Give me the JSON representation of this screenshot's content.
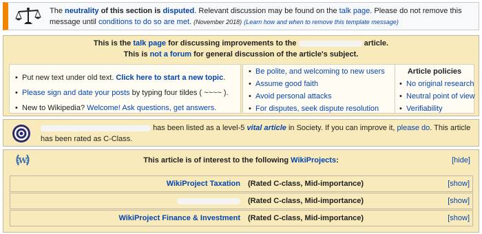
{
  "dispute": {
    "icon": "scales-icon",
    "prefix": "The ",
    "neutrality_link": "neutrality",
    "mid1": " of this section is ",
    "disputed_link": "disputed",
    "mid2": ". Relevant discussion may be found on the ",
    "talk_link": "talk page",
    "mid3": ". Please do not remove this message until ",
    "conditions_link": "conditions to do so are met",
    "mid4": ".",
    "date": "(November 2018)",
    "learn_link": "(Learn how and when to remove this template message)"
  },
  "talk_header": {
    "line1_prefix": "This is the ",
    "talk_link": "talk page",
    "line1_mid": " for discussing improvements to the ",
    "line1_suffix": " article.",
    "line2_prefix": "This is ",
    "not_forum_link": "not a forum",
    "line2_suffix": " for general discussion of the article's subject."
  },
  "talk_box": {
    "left": {
      "item1_prefix": "Put new text under old text. ",
      "item1_link": "Click here to start a new topic",
      "item1_suffix": ".",
      "item2_link": "Please sign and date your posts",
      "item2_suffix": " by typing four tildes ( ~~~~ ).",
      "item3_prefix": "New to Wikipedia? ",
      "item3_link1": "Welcome!",
      "item3_link2": "Ask questions, get answers."
    },
    "middle": [
      "Be polite, and welcoming to new users",
      "Assume good faith",
      "Avoid personal attacks",
      "For disputes, seek dispute resolution"
    ],
    "policies": {
      "title": "Article policies",
      "items": [
        "No original research",
        "Neutral point of view",
        "Verifiability"
      ]
    }
  },
  "vital": {
    "icon": "target-icon",
    "text1": "has been listed as a level-5 ",
    "vital_link": "vital article",
    "text2": " in Society. If you can improve it, ",
    "please_link": "please do",
    "text3": ". This article has been rated as C-Class."
  },
  "wikiprojects": {
    "icon": "wikipedia-laurel-icon",
    "header_prefix": "This article is of interest to the following ",
    "header_link": "WikiProjects",
    "header_suffix": ":",
    "hide_label": "[hide]",
    "rows": [
      {
        "name": "WikiProject Taxation",
        "rated": "(Rated C-class, Mid-importance)",
        "show": "[show]"
      },
      {
        "name": "",
        "rated": "(Rated C-class, Mid-importance)",
        "show": "[show]"
      },
      {
        "name": "WikiProject Finance & Investment",
        "rated": "(Rated C-class, Mid-importance)",
        "show": "[show]"
      }
    ]
  },
  "colors": {
    "banner_accent": "#f28500",
    "talk_bg": "#f8eaba",
    "link": "#0645ad"
  }
}
